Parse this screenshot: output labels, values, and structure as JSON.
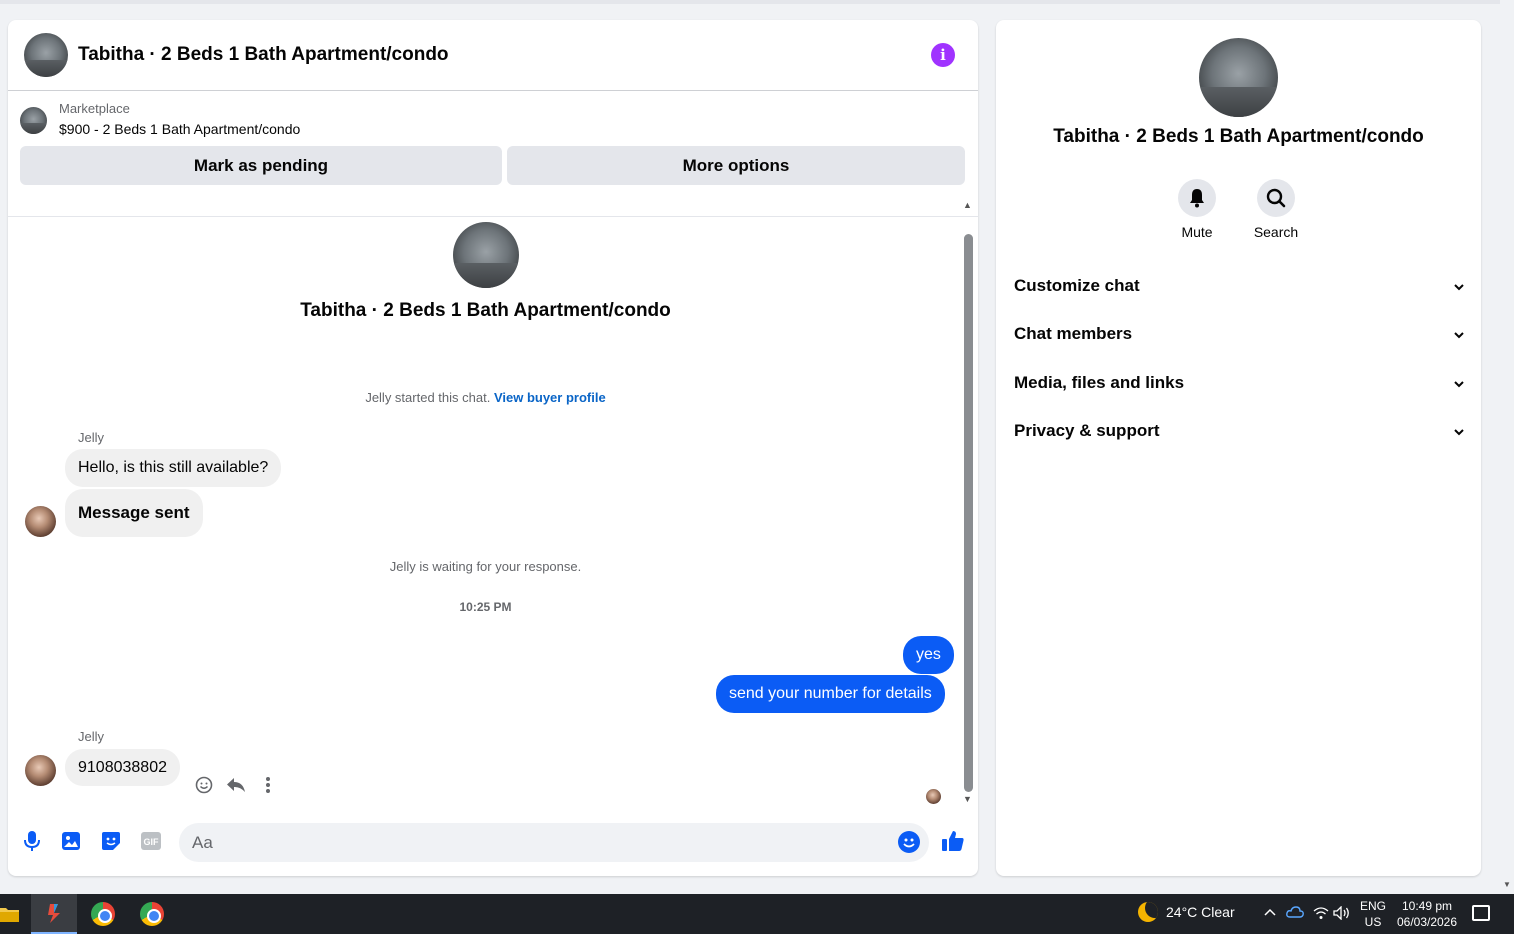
{
  "chat": {
    "title": "Tabitha · 2 Beds 1 Bath Apartment/condo",
    "listing": {
      "source": "Marketplace",
      "price_title": "$900 - 2 Beds 1 Bath Apartment/condo",
      "pending_label": "Mark as pending",
      "more_label": "More options"
    },
    "hero_title": "Tabitha · 2 Beds 1 Bath Apartment/condo",
    "started_text": "Jelly started this chat.",
    "buyer_link": "View buyer profile",
    "sender1": "Jelly",
    "msg1": "Hello, is this still available?",
    "msg2": "Message sent",
    "waiting_text": "Jelly is waiting for your response.",
    "time": "10:25 PM",
    "out1": "yes",
    "out2": "send your number for details",
    "sender2": "Jelly",
    "msg3": "9108038802",
    "input_placeholder": "Aa"
  },
  "info": {
    "title": "Tabitha · 2 Beds 1 Bath Apartment/condo",
    "mute_label": "Mute",
    "search_label": "Search",
    "sections": [
      "Customize chat",
      "Chat members",
      "Media, files and links",
      "Privacy & support"
    ]
  },
  "taskbar": {
    "weather": "24°C  Clear",
    "lang_top": "ENG",
    "lang_bottom": "US",
    "time": "10:49 pm",
    "date": "06/03/2026"
  },
  "colors": {
    "accent": "#0b5cf5",
    "info_purple": "#a033ff",
    "link": "#0a65c7"
  }
}
